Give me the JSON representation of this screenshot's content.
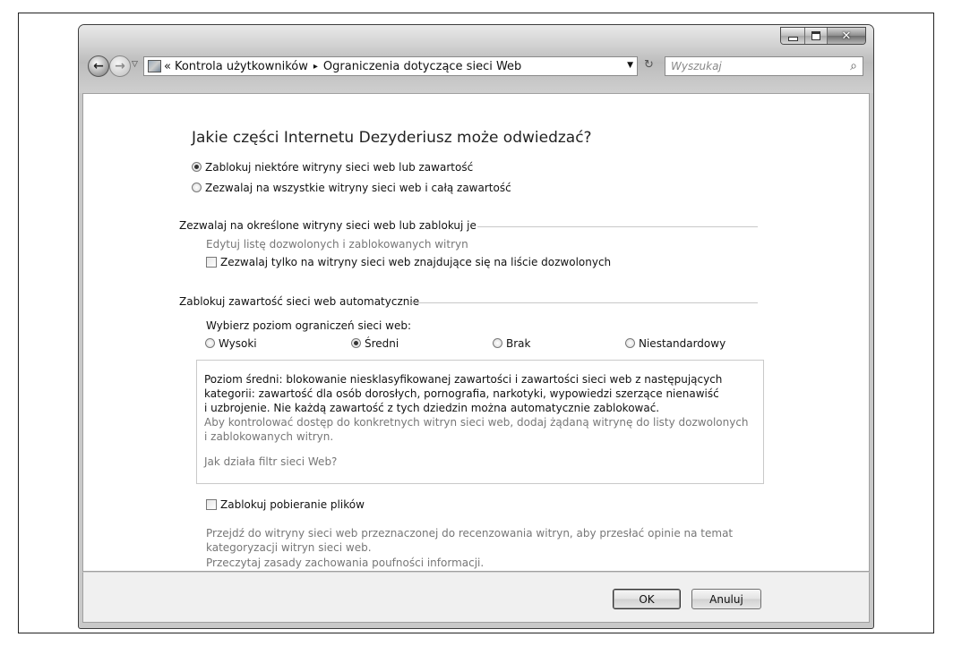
{
  "window": {
    "address": {
      "chevron": "«",
      "crumb1": "Kontrola użytkowników",
      "separator": "▸",
      "crumb2": "Ograniczenia dotyczące sieci Web"
    },
    "search_placeholder": "Wyszukaj"
  },
  "page": {
    "title": "Jakie części Internetu Dezyderiusz może odwiedzać?",
    "radio_block_some": "Zablokuj niektóre witryny sieci web lub zawartość",
    "radio_allow_all": "Zezwalaj na wszystkie witryny sieci web i całą zawartość",
    "section1_heading": "Zezwalaj na określone witryny sieci web lub zablokuj je",
    "edit_list_link": "Edytuj listę dozwolonych i zablokowanych witryn",
    "checkbox_allowed_only": "Zezwalaj tylko na witryny sieci web znajdujące się na liście dozwolonych",
    "section2_heading": "Zablokuj zawartość sieci web automatycznie",
    "level_label": "Wybierz poziom ograniczeń sieci web:",
    "levels": [
      "Wysoki",
      "Średni",
      "Brak",
      "Niestandardowy"
    ],
    "selected_level": "Średni",
    "info": {
      "line1": "Poziom średni: blokowanie niesklasyfikowanej zawartości i zawartości sieci web z następujących",
      "line2": "kategorii: zawartość dla osób dorosłych, pornografia, narkotyki, wypowiedzi szerzące nienawiść",
      "line3": "i uzbrojenie. Nie każdą zawartość z tych dziedzin można automatycznie zablokować.",
      "link_line1": "Aby kontrolować dostęp do konkretnych witryn sieci web, dodaj żądaną witrynę do listy dozwolonych",
      "link_line2": "i zablokowanych witryn.",
      "filter_link": "Jak działa filtr sieci Web?"
    },
    "checkbox_block_downloads": "Zablokuj pobieranie plików",
    "review_line1": "Przejdź do witryny sieci web przeznaczonej do recenzowania witryn, aby przesłać opinie na temat",
    "review_line2": "kategoryzacji witryn sieci web.",
    "privacy_link": "Przeczytaj zasady zachowania poufności informacji."
  },
  "footer": {
    "ok_label": "OK",
    "cancel_label": "Anuluj"
  },
  "icons": {
    "back": "back-arrow-icon",
    "forward": "forward-arrow-icon",
    "search": "magnifier-icon",
    "refresh": "refresh-icon",
    "control_panel": "control-panel-icon"
  }
}
